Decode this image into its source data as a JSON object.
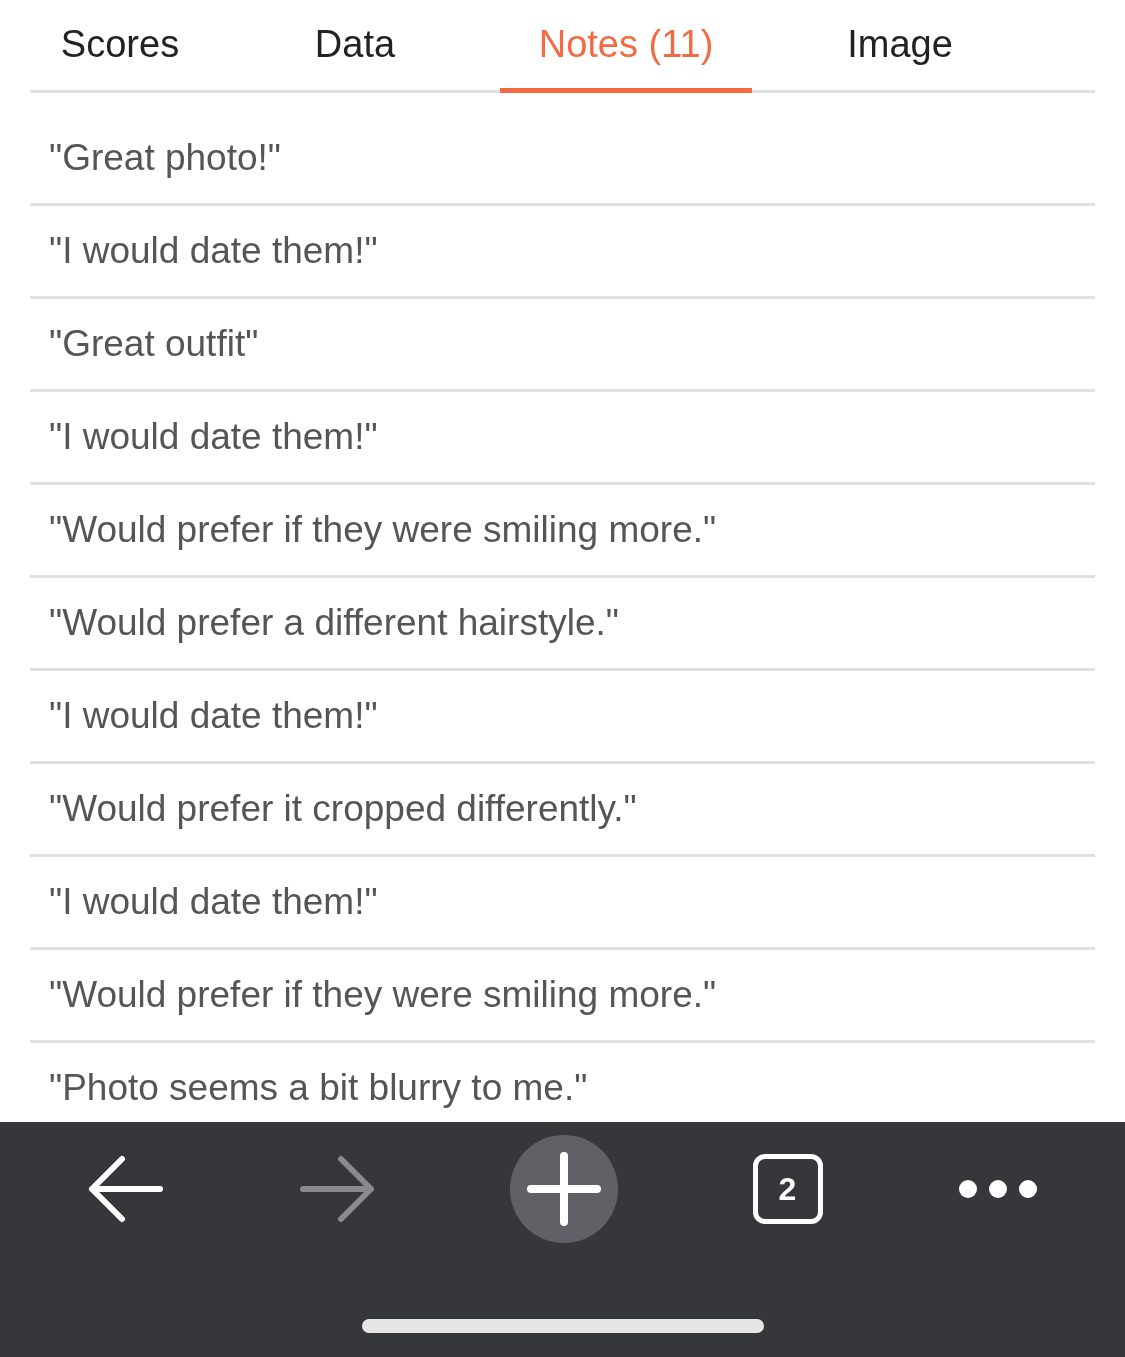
{
  "tabs": [
    {
      "label": "Scores",
      "selected": false
    },
    {
      "label": "Data",
      "selected": false
    },
    {
      "label": "Notes (11)",
      "selected": true
    },
    {
      "label": "Image",
      "selected": false
    }
  ],
  "notes": [
    "\"Great photo!\"",
    "\"I would date them!\"",
    "\"Great outfit\"",
    "\"I would date them!\"",
    "\"Would prefer if they were smiling more.\"",
    "\"Would prefer a different hairstyle.\"",
    "\"I would date them!\"",
    "\"Would prefer it cropped differently.\"",
    "\"I would date them!\"",
    "\"Would prefer if they were smiling more.\"",
    "\"Photo seems a bit blurry to me.\""
  ],
  "toolbar": {
    "back_disabled": false,
    "forward_disabled": true,
    "tab_count": "2"
  }
}
